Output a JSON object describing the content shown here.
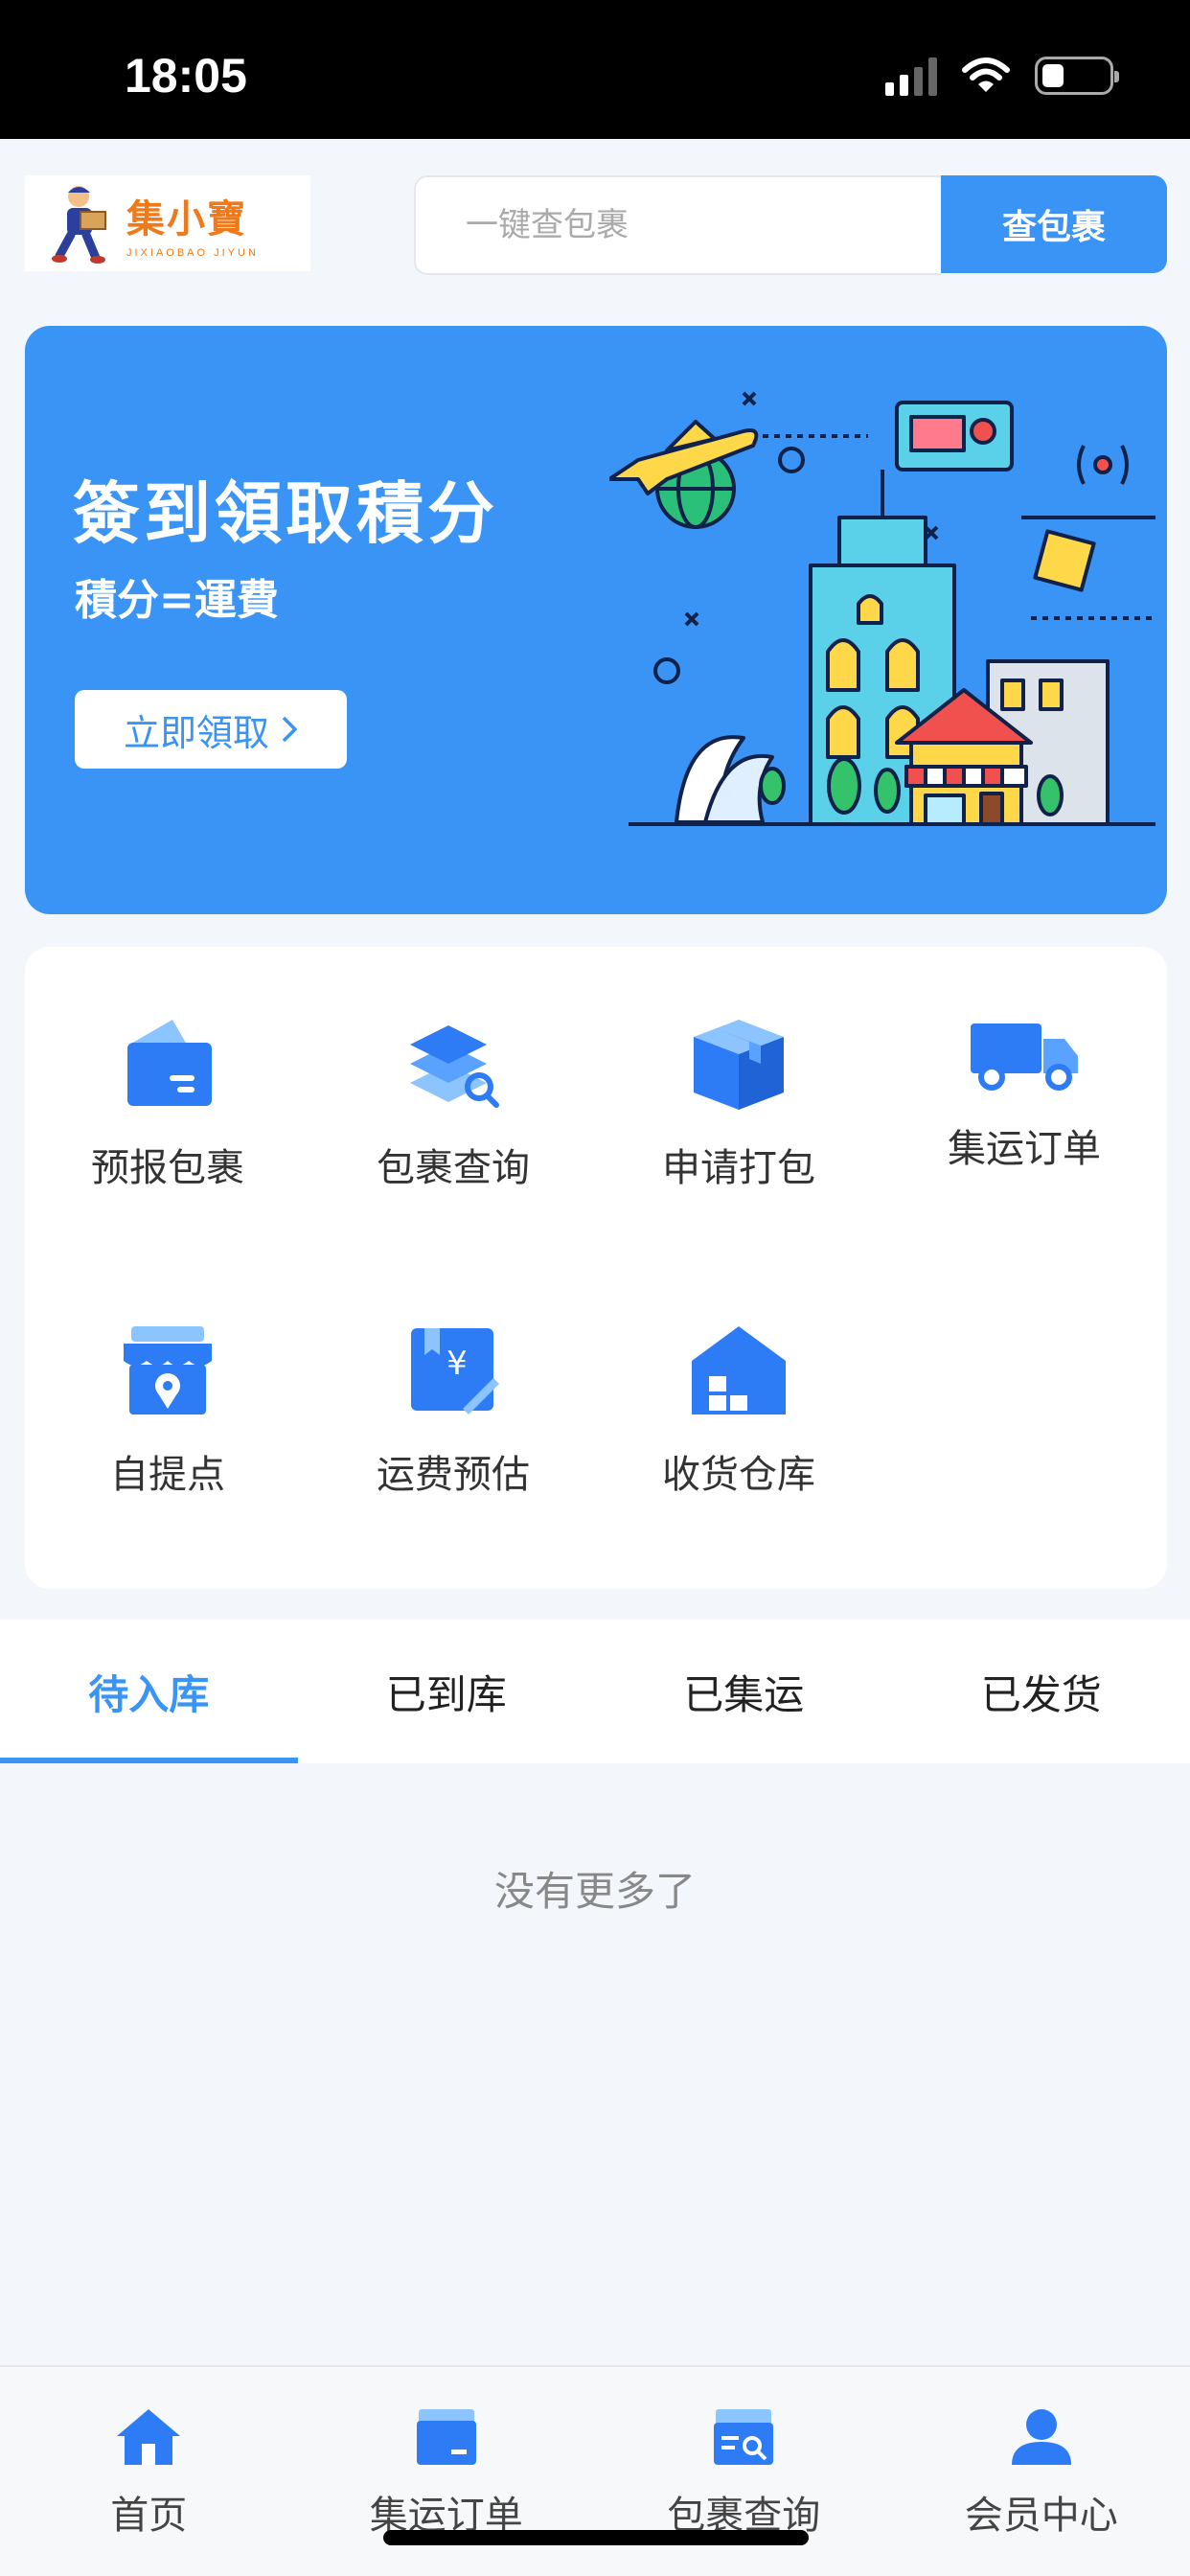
{
  "status_bar": {
    "time": "18:05"
  },
  "header": {
    "logo_name": "集小寶",
    "logo_sub": "JIXIAOBAO JIYUN",
    "search_placeholder": "一键查包裹",
    "search_button": "查包裹"
  },
  "banner": {
    "title": "簽到領取積分",
    "subtitle": "積分=運費",
    "button": "立即領取"
  },
  "grid": [
    {
      "label": "预报包裹",
      "icon": "forecast-package-icon"
    },
    {
      "label": "包裹查询",
      "icon": "package-search-icon"
    },
    {
      "label": "申请打包",
      "icon": "box-icon"
    },
    {
      "label": "集运订单",
      "icon": "truck-icon"
    },
    {
      "label": "自提点",
      "icon": "store-pin-icon"
    },
    {
      "label": "运费预估",
      "icon": "fee-estimate-icon"
    },
    {
      "label": "收货仓库",
      "icon": "warehouse-icon"
    }
  ],
  "tabs": [
    "待入库",
    "已到库",
    "已集运",
    "已发货"
  ],
  "active_tab": "待入库",
  "empty_text": "没有更多了",
  "bottom_nav": [
    {
      "label": "首页",
      "icon": "home-icon"
    },
    {
      "label": "集运订单",
      "icon": "order-box-icon"
    },
    {
      "label": "包裹查询",
      "icon": "package-search-icon"
    },
    {
      "label": "会员中心",
      "icon": "user-icon"
    }
  ],
  "colors": {
    "accent": "#3a94f5",
    "logo": "#f07a1a",
    "background": "#f3f6fa"
  }
}
